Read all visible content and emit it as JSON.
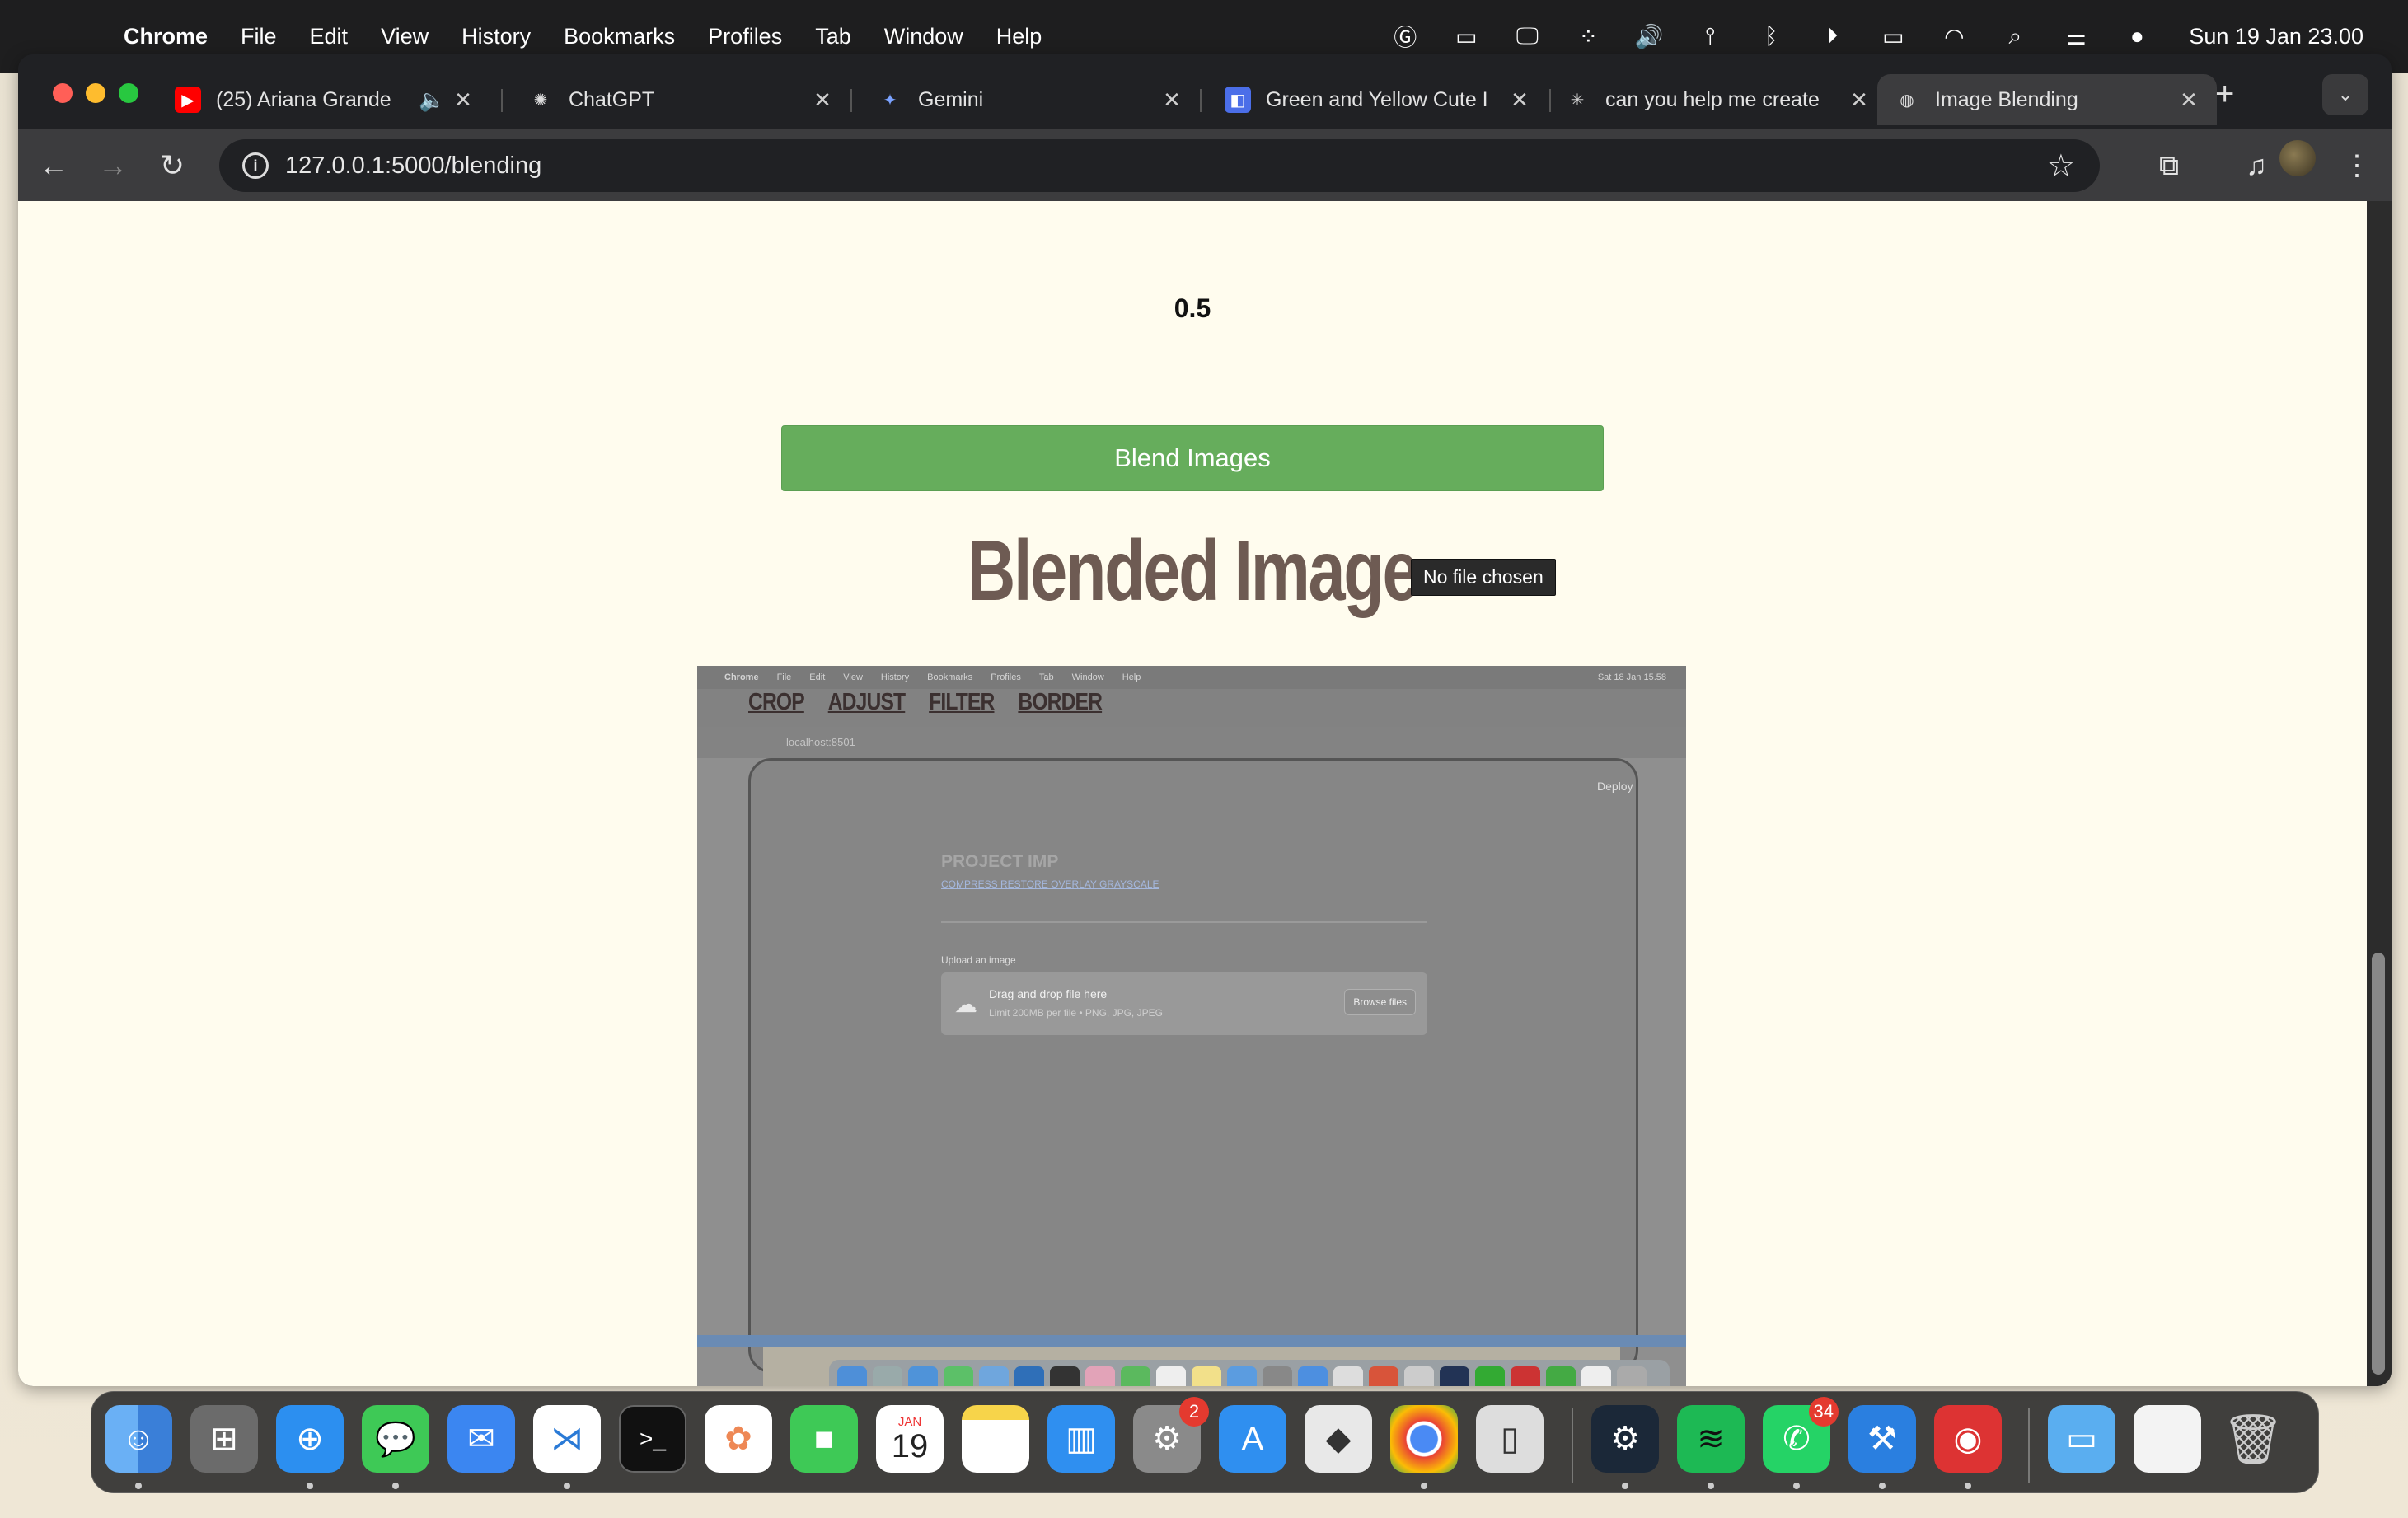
{
  "menubar": {
    "app": "Chrome",
    "items": [
      "File",
      "Edit",
      "View",
      "History",
      "Bookmarks",
      "Profiles",
      "Tab",
      "Window",
      "Help"
    ],
    "clock": "Sun 19 Jan  23.00"
  },
  "tabs": [
    {
      "title": "(25) Ariana Grande",
      "icon": "youtube-icon",
      "audio": true
    },
    {
      "title": "ChatGPT",
      "icon": "chatgpt-icon"
    },
    {
      "title": "Gemini",
      "icon": "gemini-icon"
    },
    {
      "title": "Green and Yellow Cute I",
      "icon": "canva-icon"
    },
    {
      "title": "can you help me create",
      "icon": "perplexity-icon"
    },
    {
      "title": "Image Blending",
      "icon": "globe-icon",
      "active": true
    }
  ],
  "address": {
    "url": "127.0.0.1:5000/blending"
  },
  "page": {
    "alpha_value": "0.5",
    "blend_button": "Blend Images",
    "heading": "Blended Image",
    "tooltip": "No file chosen"
  },
  "blended_image": {
    "menubar_items": [
      "Chrome",
      "File",
      "Edit",
      "View",
      "History",
      "Bookmarks",
      "Profiles",
      "Tab",
      "Window",
      "Help"
    ],
    "menubar_clock": "Sat 18 Jan  15.58",
    "url": "localhost:8501",
    "nav_links": [
      "CROP",
      "ADJUST",
      "FILTER",
      "BORDER"
    ],
    "deploy": "Deploy",
    "project_title": "PROJECT IMP",
    "sub_links": "COMPRESS RESTORE OVERLAY GRAYSCALE",
    "upload_label": "Upload an image",
    "drop_text": "Drag and drop file here",
    "limit_text": "Limit 200MB per file • PNG, JPG, JPEG",
    "browse": "Browse files"
  },
  "dock": {
    "calendar_month": "JAN",
    "calendar_day": "19",
    "settings_badge": "2",
    "whatsapp_badge": "34"
  },
  "colors": {
    "page_bg": "#fffcee",
    "button_green": "#66ad5c",
    "heading_brown": "#6e5b53"
  }
}
